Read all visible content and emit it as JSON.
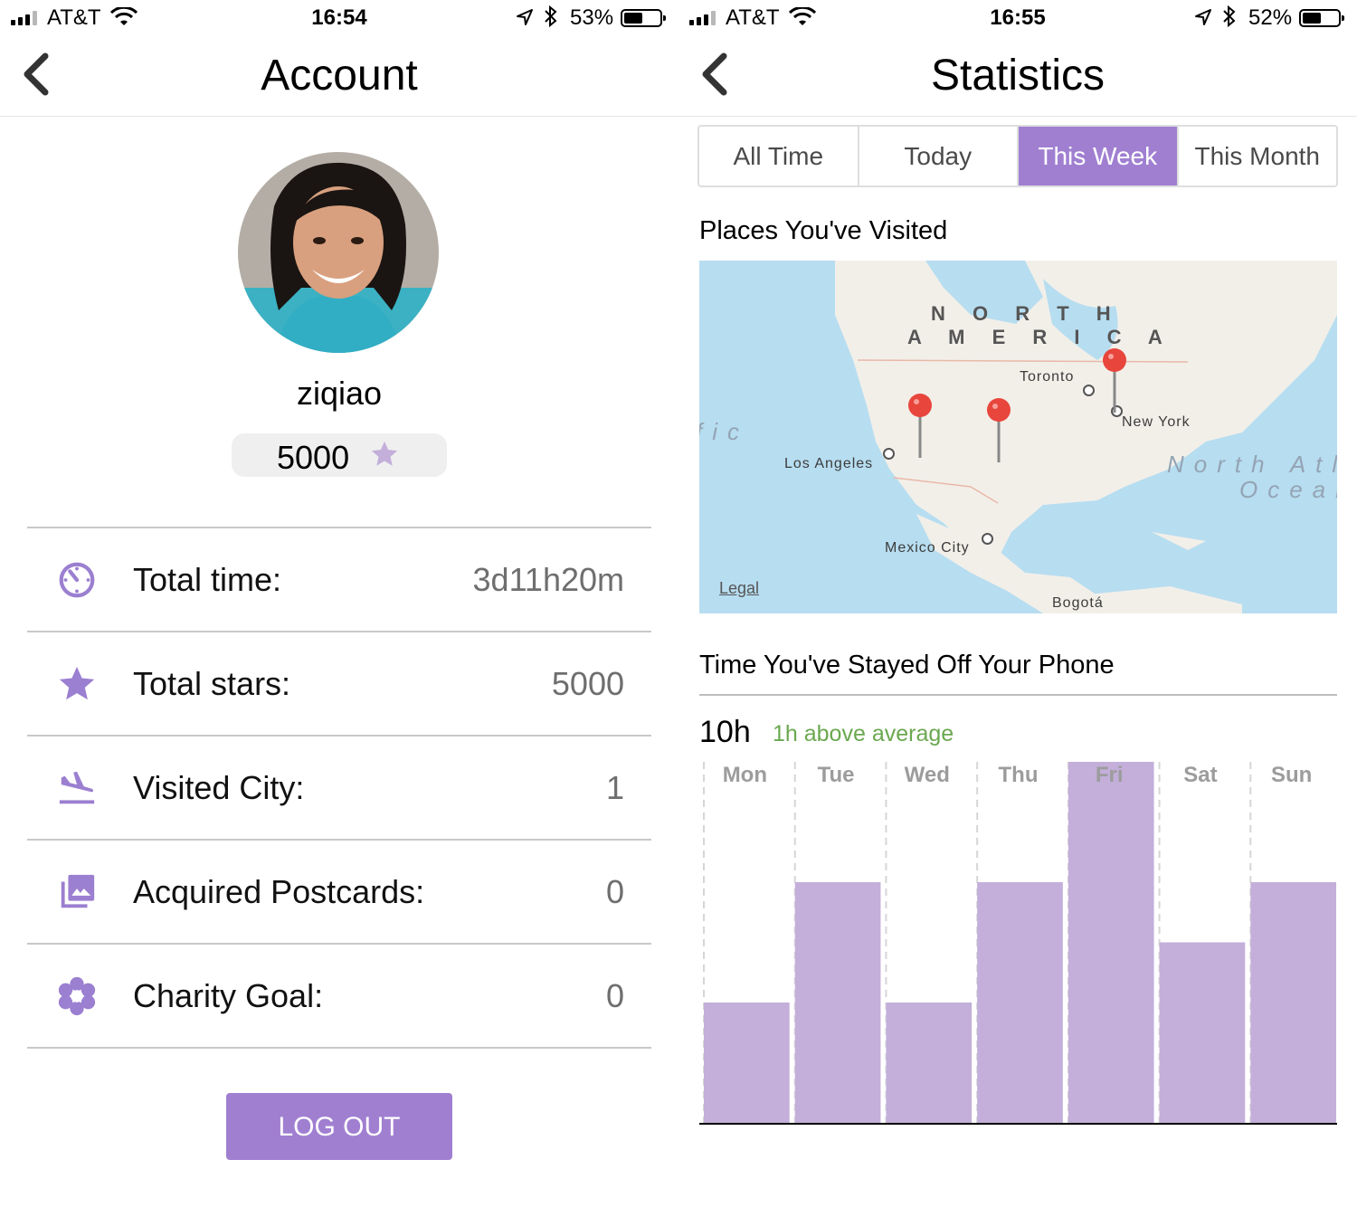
{
  "left_screen": {
    "status_bar": {
      "carrier": "AT&T",
      "time": "16:54",
      "battery_pct": "53%",
      "battery_level": 0.53
    },
    "nav": {
      "title": "Account"
    },
    "profile": {
      "username": "ziqiao",
      "stars": "5000"
    },
    "stats": [
      {
        "icon": "timer-icon",
        "label": "Total time:",
        "value": "3d11h20m"
      },
      {
        "icon": "star-icon",
        "label": "Total stars:",
        "value": "5000"
      },
      {
        "icon": "flight-land-icon",
        "label": "Visited City:",
        "value": "1"
      },
      {
        "icon": "photo-library-icon",
        "label": "Acquired Postcards:",
        "value": "0"
      },
      {
        "icon": "flower-icon",
        "label": "Charity Goal:",
        "value": "0"
      }
    ],
    "logout_label": "LOG OUT"
  },
  "right_screen": {
    "status_bar": {
      "carrier": "AT&T",
      "time": "16:55",
      "battery_pct": "52%",
      "battery_level": 0.52
    },
    "nav": {
      "title": "Statistics"
    },
    "tabs": [
      {
        "label": "All Time",
        "active": false
      },
      {
        "label": "Today",
        "active": false
      },
      {
        "label": "This Week",
        "active": true
      },
      {
        "label": "This Month",
        "active": false
      }
    ],
    "places_title": "Places You've Visited",
    "map": {
      "region_label_1": "N O R T H",
      "region_label_2": "A M E R I C A",
      "ocean_1": "North Atla",
      "ocean_2": "Ocean",
      "ocean_3": "fic",
      "cities": [
        "Toronto",
        "New York",
        "Los Angeles",
        "Mexico City",
        "Bogotá"
      ],
      "legal": "Legal"
    },
    "offphone_title": "Time You've Stayed Off Your Phone",
    "total": "10h",
    "total_note": "1h above average",
    "accent": "#a07fd1",
    "bar_color": "#c3afda",
    "chart_data": {
      "type": "bar",
      "categories": [
        "Mon",
        "Tue",
        "Wed",
        "Thu",
        "Fri",
        "Sat",
        "Sun"
      ],
      "values": [
        1,
        2,
        1,
        2,
        3,
        1.5,
        2
      ],
      "ylim": [
        0,
        3
      ],
      "grid": "dashed vertical separators"
    }
  }
}
